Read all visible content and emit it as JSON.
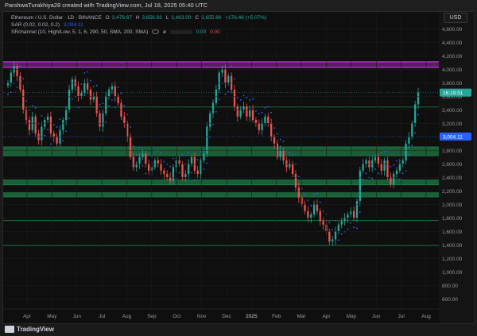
{
  "header": {
    "creator": "ParshwaTurakhiya28 created with TradingView.com, Jul 18, 2025 05:40 UTC"
  },
  "legend": {
    "symbol": "Ethereum / U.S. Dollar · 1D · BINANCE",
    "o_label": "O",
    "o_value": "3,479.67",
    "h_label": "H",
    "h_value": "3,656.93",
    "l_label": "L",
    "l_value": "3,463.00",
    "c_label": "C",
    "c_value": "3,655.86",
    "change": "+176.46 (+5.07%)",
    "sar_label": "SAR (0.02, 0.02, 0.2)",
    "sar_value": "3,004.11",
    "sr_label": "SRchannel (10, High/Low, 5, 1, 6, 290, 50, SMA, 200, SMA)",
    "sr_icon": "ø",
    "sr_v0": "0.00",
    "sr_v1": "0.00"
  },
  "currency_button": "USD",
  "footer": {
    "brand": "TradingView"
  },
  "chart_data": {
    "type": "candlestick",
    "symbol": "Ethereum / U.S. Dollar",
    "timeframe": "1D",
    "exchange": "BINANCE",
    "ylim": [
      450,
      4850
    ],
    "y_ticks": [
      4600,
      4400,
      4200,
      4000,
      3800,
      3600,
      3400,
      3200,
      3000,
      2800,
      2600,
      2400,
      2200,
      2000,
      1800,
      1600,
      1400,
      1200,
      1000,
      800,
      600
    ],
    "y_tick_labels": [
      "4,600.00",
      "4,400.00",
      "4,200.00",
      "4,000.00",
      "3,800.00",
      "3,600.00",
      "3,400.00",
      "3,200.00",
      "3,000.00",
      "2,800.00",
      "2,600.00",
      "2,400.00",
      "2,200.00",
      "2,000.00",
      "1,800.00",
      "1,600.00",
      "1,400.00",
      "1,200.00",
      "1,000.00",
      "800.00",
      "600.00"
    ],
    "x_ticks": [
      "Apr",
      "May",
      "Jun",
      "Jul",
      "Aug",
      "Sep",
      "Oct",
      "Nov",
      "Dec",
      "2025",
      "Feb",
      "Mar",
      "Apr",
      "May",
      "Jun",
      "Jul",
      "Aug"
    ],
    "price_labels": [
      {
        "text": "16:19:51",
        "value": 3655,
        "color": "#26a69a"
      },
      {
        "text": "3,004.11",
        "value": 3004,
        "color": "#2962ff"
      }
    ],
    "zones": [
      {
        "from": 4030,
        "to": 4110,
        "color": "#e040fb"
      },
      {
        "from": 2720,
        "to": 2850,
        "color": "#1e7a45"
      },
      {
        "from": 2290,
        "to": 2360,
        "color": "#1e7a45"
      },
      {
        "from": 2110,
        "to": 2170,
        "color": "#1e7a45"
      }
    ],
    "levels": [
      3440,
      1760,
      1390
    ],
    "close_series": [
      3800,
      3950,
      4050,
      3900,
      3700,
      3400,
      3250,
      3100,
      3300,
      3050,
      2950,
      3150,
      3250,
      3300,
      3050,
      3000,
      2900,
      3100,
      3250,
      3400,
      3700,
      3850,
      3750,
      3600,
      3650,
      3800,
      3700,
      3550,
      3600,
      3350,
      3150,
      3350,
      3600,
      3700,
      3750,
      3600,
      3500,
      3300,
      3200,
      3000,
      2700,
      2550,
      2600,
      2700,
      2750,
      2600,
      2500,
      2550,
      2650,
      2600,
      2500,
      2450,
      2400,
      2350,
      2550,
      2650,
      2600,
      2400,
      2450,
      2600,
      2700,
      2500,
      2450,
      2650,
      2750,
      3150,
      3350,
      3500,
      3700,
      3950,
      4000,
      3800,
      3900,
      3700,
      3450,
      3300,
      3400,
      3450,
      3300,
      3400,
      3250,
      3200,
      3100,
      3200,
      3300,
      3200,
      3000,
      2900,
      2700,
      2800,
      2650,
      2550,
      2600,
      2450,
      2250,
      2100,
      2000,
      1900,
      1800,
      1850,
      2000,
      1900,
      1750,
      1700,
      1600,
      1450,
      1480,
      1600,
      1700,
      1750,
      1800,
      1850,
      1900,
      1800,
      2050,
      2500,
      2600,
      2650,
      2550,
      2650,
      2700,
      2600,
      2500,
      2650,
      2400,
      2300,
      2450,
      2500,
      2600,
      2650,
      2900,
      3000,
      3200,
      3480,
      3656
    ]
  }
}
